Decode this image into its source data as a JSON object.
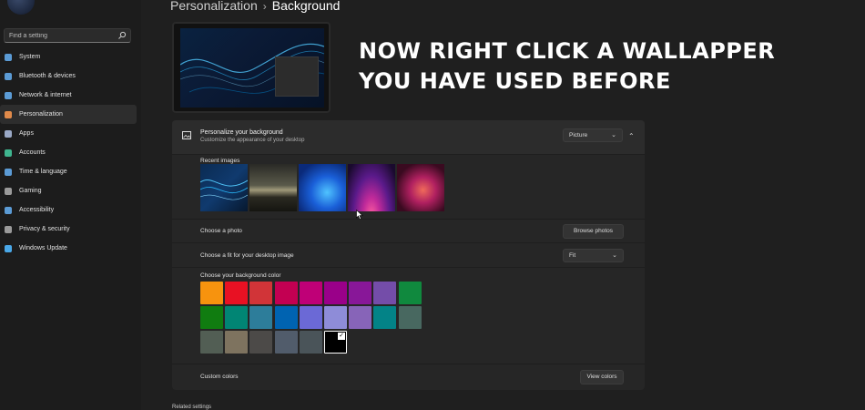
{
  "breadcrumb": {
    "parent": "Personalization",
    "current": "Background"
  },
  "search": {
    "placeholder": "Find a setting"
  },
  "sidebar": {
    "items": [
      {
        "label": "System",
        "icon": "monitor-icon",
        "color": "#5b9bd5"
      },
      {
        "label": "Bluetooth & devices",
        "icon": "bluetooth-icon",
        "color": "#5b9bd5"
      },
      {
        "label": "Network & internet",
        "icon": "wifi-icon",
        "color": "#5b9bd5"
      },
      {
        "label": "Personalization",
        "icon": "brush-icon",
        "color": "#e08a4a",
        "active": true
      },
      {
        "label": "Apps",
        "icon": "apps-icon",
        "color": "#9aa9c6"
      },
      {
        "label": "Accounts",
        "icon": "person-icon",
        "color": "#3fb58f"
      },
      {
        "label": "Time & language",
        "icon": "globe-clock-icon",
        "color": "#5b9bd5"
      },
      {
        "label": "Gaming",
        "icon": "gamepad-icon",
        "color": "#9a9a9a"
      },
      {
        "label": "Accessibility",
        "icon": "accessibility-icon",
        "color": "#5b9bd5"
      },
      {
        "label": "Privacy & security",
        "icon": "shield-icon",
        "color": "#9a9a9a"
      },
      {
        "label": "Windows Update",
        "icon": "update-icon",
        "color": "#4aa8e8"
      }
    ]
  },
  "overlay": {
    "line1": "NOW RIGHT CLICK A WALLAPPER",
    "line2": "YOU HAVE USED BEFORE"
  },
  "personalize": {
    "title": "Personalize your background",
    "subtitle": "Customize the appearance of your desktop",
    "selected": "Picture",
    "recent_label": "Recent images"
  },
  "choose_photo": {
    "label": "Choose a photo",
    "button": "Browse photos"
  },
  "fit": {
    "label": "Choose a fit for your desktop image",
    "selected": "Fit"
  },
  "bg_color": {
    "label": "Choose your background color",
    "rows": [
      [
        "#f7930e",
        "#e81123",
        "#d13438",
        "#c30052",
        "#bf0077",
        "#9a0089",
        "#881798",
        "#744da9",
        "#10893e"
      ],
      [
        "#107c10",
        "#018574",
        "#2d7d9a",
        "#0063b1",
        "#6b69d6",
        "#8e8cd8",
        "#8764b8",
        "#038387",
        "#486860"
      ],
      [
        "#525e54",
        "#7e735f",
        "#4c4a48",
        "#515c6b",
        "#4a5459",
        "#000000"
      ]
    ],
    "selected_color": "#000000"
  },
  "custom_colors": {
    "label": "Custom colors",
    "button": "View colors"
  },
  "related": {
    "label": "Related settings"
  }
}
